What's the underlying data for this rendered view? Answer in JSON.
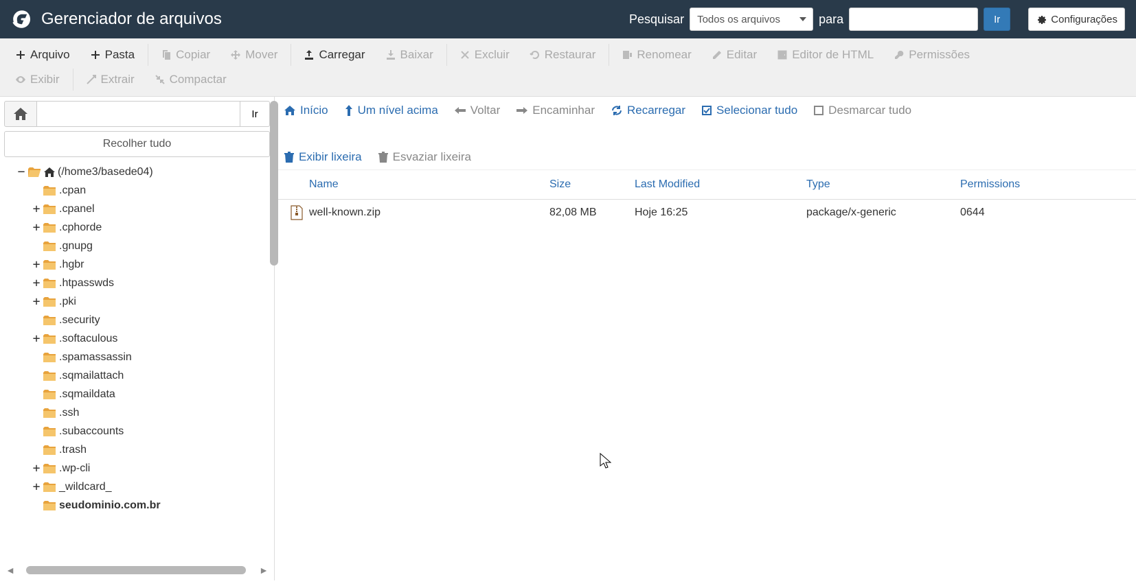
{
  "header": {
    "title": "Gerenciador de arquivos",
    "search_label": "Pesquisar",
    "search_select": "Todos os arquivos",
    "for_label": "para",
    "go": "Ir",
    "settings": "Configurações"
  },
  "toolbar": {
    "file": "Arquivo",
    "folder": "Pasta",
    "copy": "Copiar",
    "move": "Mover",
    "upload": "Carregar",
    "download": "Baixar",
    "delete": "Excluir",
    "restore": "Restaurar",
    "rename": "Renomear",
    "edit": "Editar",
    "html_editor": "Editor de HTML",
    "permissions": "Permissões",
    "view": "Exibir",
    "extract": "Extrair",
    "compress": "Compactar"
  },
  "sidebar": {
    "go": "Ir",
    "collapse_all": "Recolher tudo",
    "root_label": "(/home3/basede04)",
    "items": [
      {
        "label": ".cpan",
        "expandable": false
      },
      {
        "label": ".cpanel",
        "expandable": true
      },
      {
        "label": ".cphorde",
        "expandable": true
      },
      {
        "label": ".gnupg",
        "expandable": false
      },
      {
        "label": ".hgbr",
        "expandable": true
      },
      {
        "label": ".htpasswds",
        "expandable": true
      },
      {
        "label": ".pki",
        "expandable": true
      },
      {
        "label": ".security",
        "expandable": false
      },
      {
        "label": ".softaculous",
        "expandable": true
      },
      {
        "label": ".spamassassin",
        "expandable": false
      },
      {
        "label": ".sqmailattach",
        "expandable": false
      },
      {
        "label": ".sqmaildata",
        "expandable": false
      },
      {
        "label": ".ssh",
        "expandable": false
      },
      {
        "label": ".subaccounts",
        "expandable": false
      },
      {
        "label": ".trash",
        "expandable": false
      },
      {
        "label": ".wp-cli",
        "expandable": true
      },
      {
        "label": "_wildcard_",
        "expandable": true
      },
      {
        "label": "seudominio.com.br",
        "expandable": false,
        "bold": true
      }
    ]
  },
  "actionbar": {
    "home": "Início",
    "up": "Um nível acima",
    "back": "Voltar",
    "forward": "Encaminhar",
    "reload": "Recarregar",
    "select_all": "Selecionar tudo",
    "unselect_all": "Desmarcar tudo",
    "view_trash": "Exibir lixeira",
    "empty_trash": "Esvaziar lixeira"
  },
  "table": {
    "headers": {
      "name": "Name",
      "size": "Size",
      "modified": "Last Modified",
      "type": "Type",
      "permissions": "Permissions"
    },
    "rows": [
      {
        "name": "well-known.zip",
        "size": "82,08 MB",
        "modified": "Hoje 16:25",
        "type": "package/x-generic",
        "permissions": "0644"
      }
    ]
  }
}
